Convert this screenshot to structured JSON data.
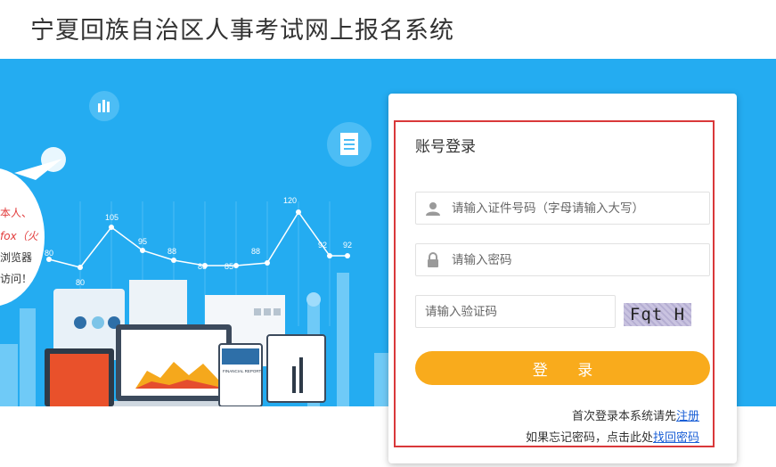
{
  "header": {
    "title": "宁夏回族自治区人事考试网上报名系统"
  },
  "banner": {
    "bubble_lines": [
      {
        "text": "本人、",
        "color": "#e23c3c"
      },
      {
        "text": "fox（火",
        "color": "#e23c3c"
      },
      {
        "text": "浏览器",
        "color": "#333333"
      },
      {
        "text": "访问！",
        "color": "#333333"
      }
    ],
    "chart_labels": [
      "80",
      "80",
      "105",
      "95",
      "88",
      "85",
      "85",
      "88",
      "120",
      "92",
      "92"
    ],
    "report_label": "FINANCIAL REPORT"
  },
  "login": {
    "title": "账号登录",
    "id_placeholder": "请输入证件号码（字母请输入大写）",
    "password_placeholder": "请输入密码",
    "captcha_placeholder": "请输入验证码",
    "captcha_text": "Fqt H",
    "submit_label": "登 录",
    "register_prefix": "首次登录本系统请先",
    "register_link": "注册",
    "recover_prefix": "如果忘记密码，点击此处",
    "recover_link": "找回密码"
  },
  "colors": {
    "banner": "#24acf1",
    "button": "#f9ab1c",
    "highlight": "#d9383a",
    "link": "#1a5fd6"
  }
}
